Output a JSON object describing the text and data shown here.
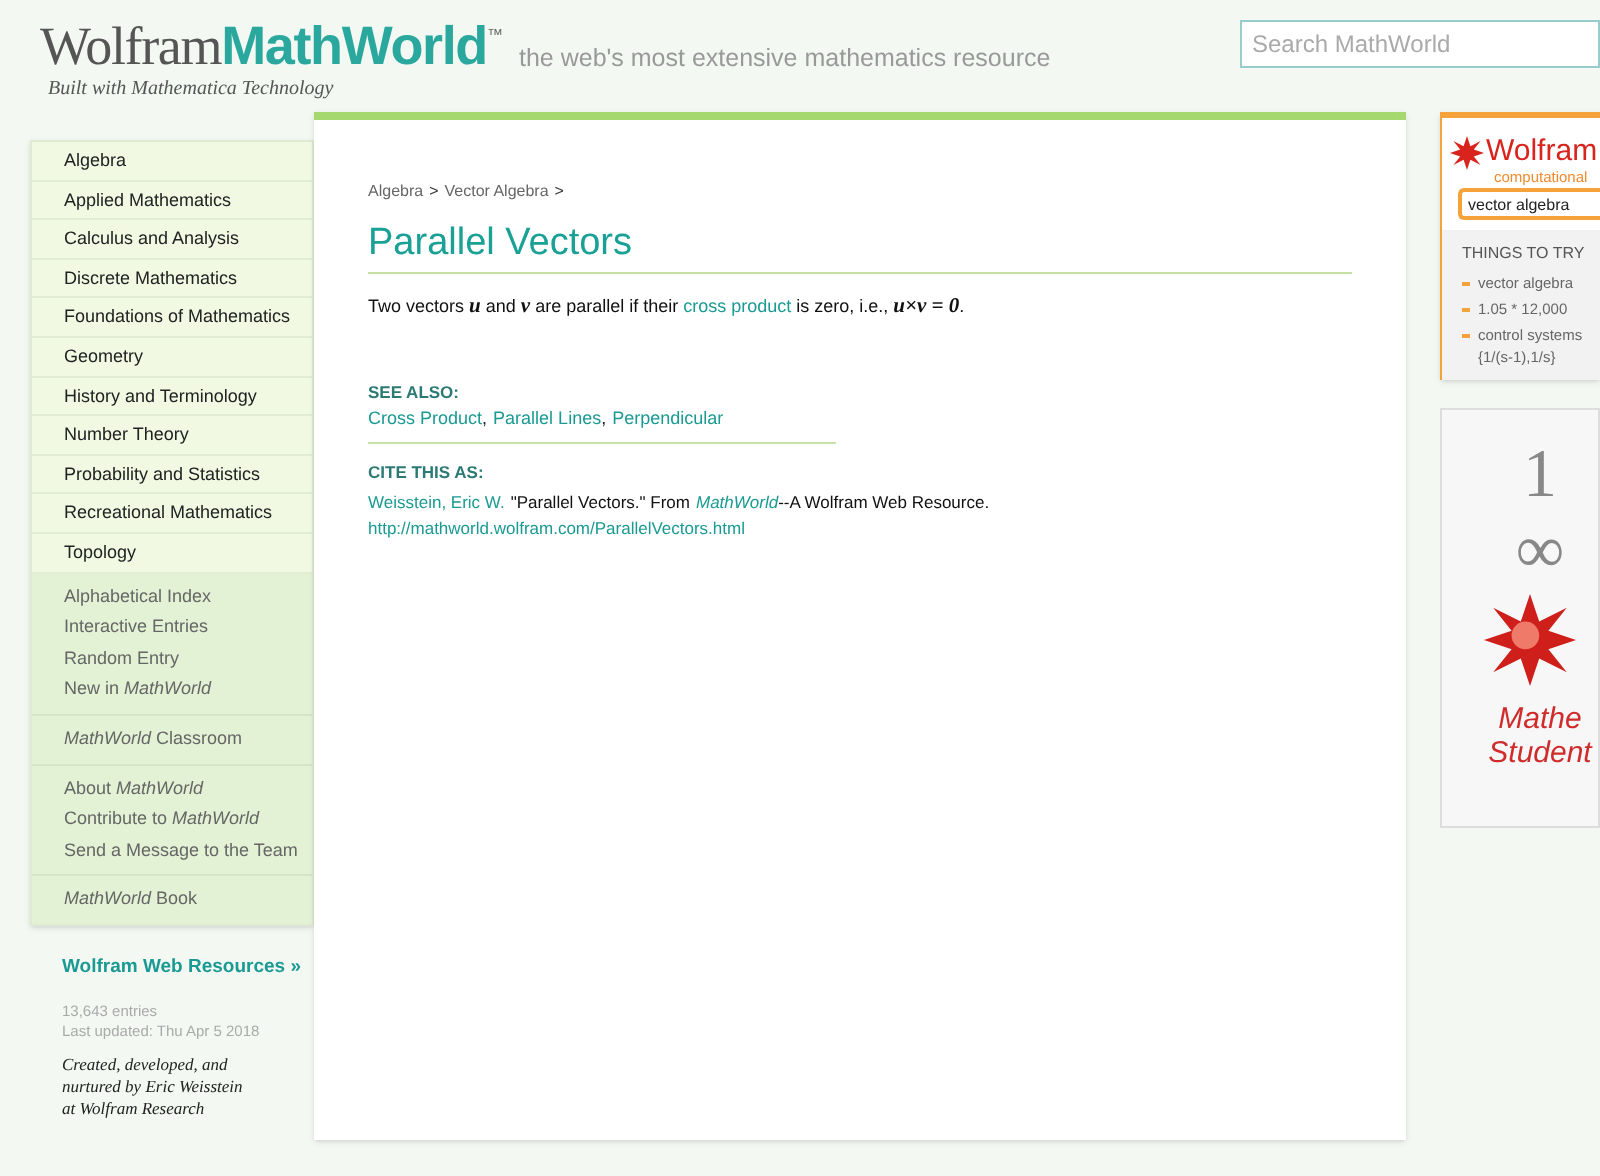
{
  "header": {
    "logo_main": "Wolfram",
    "logo_accent": "MathWorld",
    "trademark": "™",
    "built_with": "Built with Mathematica Technology",
    "slogan": "the web's most extensive mathematics resource",
    "search": {
      "placeholder": "Search MathWorld"
    }
  },
  "sidebar": {
    "categories": [
      "Algebra",
      "Applied Mathematics",
      "Calculus and Analysis",
      "Discrete Mathematics",
      "Foundations of Mathematics",
      "Geometry",
      "History and Terminology",
      "Number Theory",
      "Probability and Statistics",
      "Recreational Mathematics",
      "Topology"
    ],
    "groups": [
      [
        "Alphabetical Index",
        "Interactive Entries",
        "Random Entry",
        "New in *MathWorld*"
      ],
      [
        "*MathWorld* Classroom"
      ],
      [
        "About *MathWorld*",
        "Contribute to *MathWorld*",
        "Send a Message to the Team"
      ],
      [
        "*MathWorld* Book"
      ]
    ],
    "resources_link": "Wolfram Web Resources »",
    "entries": "13,643 entries",
    "updated": "Last updated: Thu Apr 5 2018",
    "credit": [
      "Created, developed, and",
      "nurtured by Eric Weisstein",
      "at Wolfram Research"
    ]
  },
  "article": {
    "breadcrumb": [
      {
        "kind": "link",
        "text": "Algebra"
      },
      {
        "kind": "sep",
        "text": ">"
      },
      {
        "kind": "link",
        "text": "Vector Algebra"
      },
      {
        "kind": "sep",
        "text": ">"
      }
    ],
    "title": "Parallel Vectors",
    "definition": [
      {
        "kind": "text",
        "text": "Two vectors "
      },
      {
        "kind": "math",
        "text": "u"
      },
      {
        "kind": "text",
        "text": " and "
      },
      {
        "kind": "math",
        "text": "v"
      },
      {
        "kind": "text",
        "text": " are parallel if their "
      },
      {
        "kind": "link",
        "text": "cross product"
      },
      {
        "kind": "text",
        "text": " is zero, i.e., "
      },
      {
        "kind": "math",
        "text": "u×v = 0"
      },
      {
        "kind": "text",
        "text": "."
      }
    ],
    "see_also": {
      "heading": "SEE ALSO:",
      "links": [
        "Cross Product",
        "Parallel Lines",
        "Perpendicular"
      ],
      "separator": ","
    },
    "cite": {
      "heading": "CITE THIS AS:",
      "author": "Weisstein, Eric W.",
      "title_text": "\"Parallel Vectors.\" From",
      "source": "MathWorld",
      "rest": "--A Wolfram Web Resource.",
      "url": "http://mathworld.wolfram.com/ParallelVectors.html"
    }
  },
  "alpha_widget": {
    "brand": "Wolfram",
    "subtitle": "computational",
    "input_value": "vector algebra",
    "heading": "THINGS TO TRY",
    "examples": [
      [
        "vector algebra"
      ],
      [
        "1.05 * 12,000"
      ],
      [
        "control systems",
        "{1/(s-1),1/s}"
      ]
    ]
  },
  "ad": {
    "symbols": [
      "1",
      "∞"
    ],
    "caption": [
      "Mathe",
      "Student"
    ]
  }
}
